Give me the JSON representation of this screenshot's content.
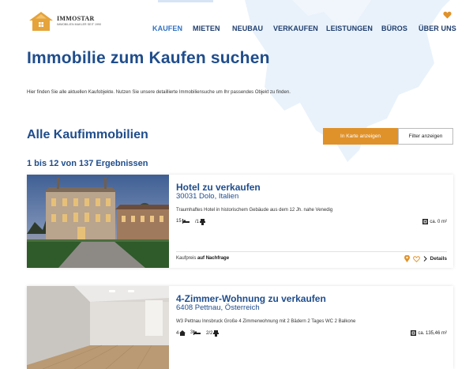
{
  "header": {
    "logo": {
      "name": "IMMOSTAR",
      "tagline": "IMMOBILIEN MAKLER SEIT 1990"
    },
    "nav": [
      {
        "label": "KAUFEN",
        "active": true
      },
      {
        "label": "MIETEN",
        "active": false
      },
      {
        "label": "NEUBAU",
        "active": false
      },
      {
        "label": "VERKAUFEN",
        "active": false
      },
      {
        "label": "LEISTUNGEN",
        "active": false
      },
      {
        "label": "BÜROS",
        "active": false
      },
      {
        "label": "ÜBER UNS",
        "active": false
      }
    ],
    "favorites_icon": "heart-icon"
  },
  "hero": {
    "title": "Immobilie zum Kaufen suchen",
    "intro": "Hier finden Sie alle aktuellen Kaufobjekte. Nutzen Sie unsere detaillierte Immobiliensuche um Ihr passendes Objekt zu finden."
  },
  "listing_section": {
    "title": "Alle Kaufimmobilien",
    "map_button": "In Karte anzeigen",
    "filter_button": "Filter anzeigen",
    "result_count": "1 bis 12 von 137 Ergebnissen"
  },
  "listings": [
    {
      "title": "Hotel zu verkaufen",
      "location": "30031 Dolo, Italien",
      "description": "Traumhaftes Hotel in historischem Gebäude aus dem 12 Jh. nahe Venedig",
      "bedrooms": "15",
      "bathrooms": "/1",
      "area": "ca. 0 m²",
      "price_label": "Kaufpreis",
      "price_value": "auf Nachfrage",
      "details_label": "Details"
    },
    {
      "title": "4-Zimmer-Wohnung zu verkaufen",
      "location": "6408 Pettnau, Österreich",
      "description": "W3 Pettnau Innsbruck Große 4 Zimmerwohnung mit 2 Bädern 2 Tages WC 2 Balkone",
      "rooms": "4",
      "bedrooms": "3",
      "bathrooms": "2/2",
      "area": "ca. 135,46 m²"
    }
  ],
  "colors": {
    "brand_blue": "#1f4d8c",
    "nav_active": "#2f72c4",
    "accent_orange": "#e0922a"
  }
}
